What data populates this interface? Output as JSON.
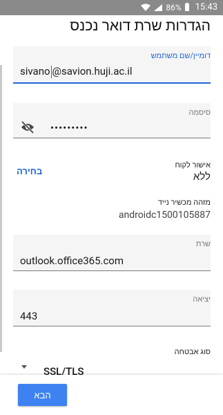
{
  "status": {
    "battery": "86%",
    "time": "15:43"
  },
  "title": "הגדרות שרת דואר נכנס",
  "username": {
    "label": "דומיין/שם משתמש",
    "value_before_cursor": "sivano",
    "value_after_cursor": "@savion.huji.ac.il"
  },
  "password": {
    "label": "סיסמה",
    "value": "•••••••••"
  },
  "client_cert": {
    "label": "אישור לקוח",
    "value": "ללא",
    "action": "בחירה"
  },
  "device_id": {
    "label": "מזהה מכשיר נייד",
    "value": "androidc1500105887"
  },
  "server": {
    "label": "שרת",
    "value": "outlook.office365.com"
  },
  "port": {
    "label": "יציאה",
    "value": "443"
  },
  "security": {
    "label": "סוג אבטחה",
    "value": "SSL/TLS"
  },
  "next_button": "הבא"
}
